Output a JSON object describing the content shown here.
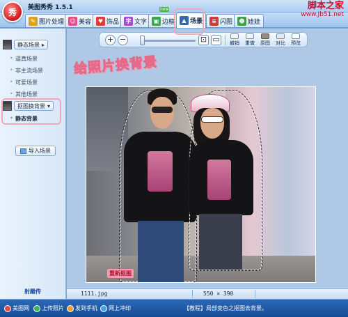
{
  "app": {
    "title": "美图秀秀 1.5.1",
    "logo_text": "秀"
  },
  "watermark": {
    "line1": "脚本之家",
    "line2": "www.Jb51.net"
  },
  "tabs": [
    {
      "label": "图片处理",
      "icon": "picture-edit-icon",
      "color": "#d9a521"
    },
    {
      "label": "美容",
      "icon": "face-icon",
      "color": "#e0508a"
    },
    {
      "label": "饰品",
      "icon": "heart-icon",
      "color": "#e23b3b"
    },
    {
      "label": "文字",
      "icon": "text-icon",
      "color": "#a24fcf"
    },
    {
      "label": "边框",
      "icon": "frame-icon",
      "color": "#3fa64f"
    },
    {
      "label": "场景",
      "icon": "scene-icon",
      "color": "#2d6ab3"
    },
    {
      "label": "闪图",
      "icon": "flash-icon",
      "color": "#d13a3a"
    },
    {
      "label": "娃娃",
      "icon": "doll-icon",
      "color": "#38a247"
    }
  ],
  "new_badge": "new",
  "left_panel": {
    "static_scene_button": "静态场景",
    "static_items": [
      "逼真场景",
      "非主流场景",
      "可爱场景",
      "其他场景"
    ],
    "cutout_button": "抠图换背景",
    "cutout_items": [
      "静态背景"
    ],
    "import_button": "导入场景",
    "bottom_link": "射雕传"
  },
  "toolbar": {
    "zoom_in": "+",
    "zoom_out": "−",
    "zoom_level": 0.0,
    "buttons": [
      "撤销",
      "重做",
      "原图",
      "对比",
      "预览"
    ]
  },
  "annotation": "给照片换背景",
  "canvas": {
    "redo_cutout_label": "重新抠图"
  },
  "status": {
    "filename": "1111.jpg",
    "dimensions": "550 × 390"
  },
  "bottom_bar": {
    "links": [
      "美图网",
      "上传照片",
      "发到手机",
      "网上冲印"
    ],
    "tip": "【教程】局部变色之抠图去背景。"
  },
  "colors": {
    "accent_pink": "#f0a8b8",
    "bottom_blue": "#1f5aa8"
  }
}
